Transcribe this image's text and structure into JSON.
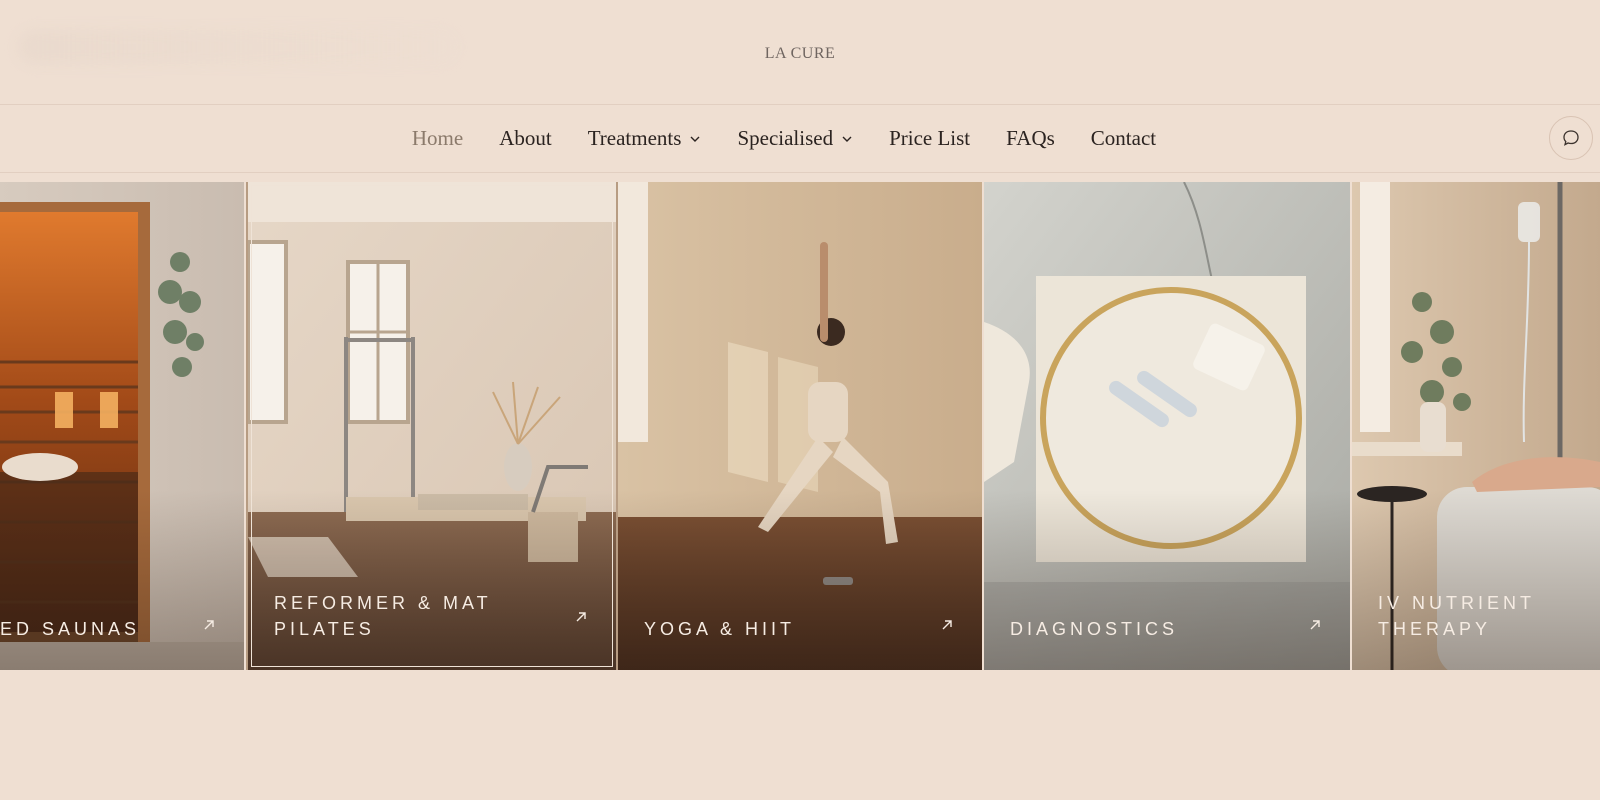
{
  "header": {
    "logo_text": "LA CURE"
  },
  "nav": {
    "items": [
      {
        "label": "Home",
        "active": true
      },
      {
        "label": "About"
      },
      {
        "label": "Treatments",
        "dropdown": true
      },
      {
        "label": "Specialised",
        "dropdown": true
      },
      {
        "label": "Price List"
      },
      {
        "label": "FAQs"
      },
      {
        "label": "Contact"
      }
    ],
    "chat_icon": "chat-bubble-icon"
  },
  "cards": [
    {
      "label": "ED SAUNAS",
      "icon": "arrow-up-right-icon"
    },
    {
      "label": "REFORMER & MAT PILATES",
      "icon": "arrow-up-right-icon",
      "selected": true
    },
    {
      "label": "YOGA & HIIT",
      "icon": "arrow-up-right-icon"
    },
    {
      "label": "DIAGNOSTICS",
      "icon": "arrow-up-right-icon"
    },
    {
      "label": "IV NUTRIENT THERAPY"
    }
  ],
  "colors": {
    "background": "#efdfd2",
    "nav_active": "#8b7a6b",
    "selection_border": "#b79c82"
  }
}
